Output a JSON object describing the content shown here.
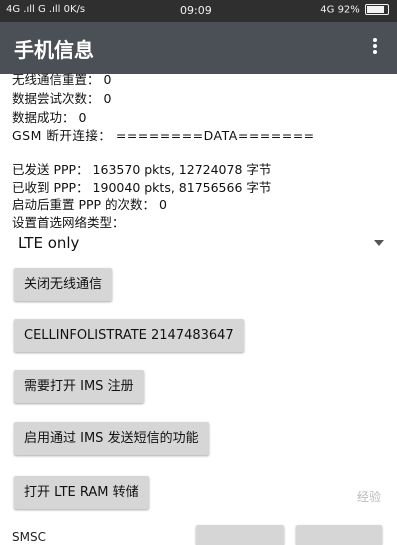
{
  "status_bar": {
    "left": "4G .ıll G .ıll 0K/s",
    "time": "09:09",
    "right": "4G 92%"
  },
  "app_bar": {
    "title": "手机信息"
  },
  "info_lines": [
    "无线通信重置： 0",
    "数据尝试次数： 0",
    "数据成功： 0",
    "GSM 断开连接： ========DATA=======",
    "已发送 PPP： 163570 pkts, 12724078 字节",
    "已收到 PPP： 190040 pkts, 81756566 字节",
    "启动后重置 PPP 的次数： 0",
    "设置首选网络类型："
  ],
  "network_type": {
    "selected": "LTE only"
  },
  "buttons": [
    "关闭无线通信",
    "CELLINFOLISTRATE 2147483647",
    "需要打开 IMS 注册",
    "启用通过 IMS 发送短信的功能",
    "打开 LTE RAM 转储"
  ],
  "bottom": {
    "partial_label": "SMSC"
  },
  "watermark": "经验"
}
